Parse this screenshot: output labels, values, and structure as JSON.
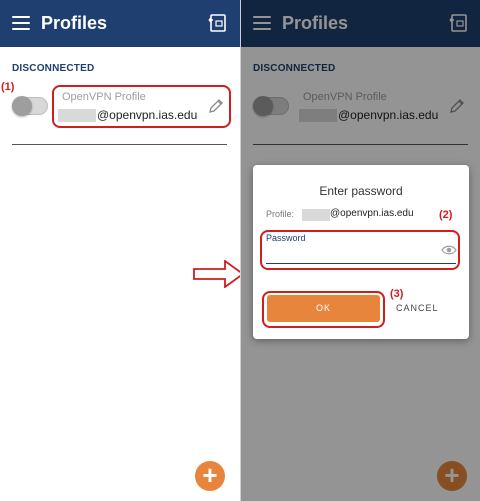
{
  "app": {
    "title": "Profiles",
    "header_color": "#1e3f6f",
    "accent_color": "#e8853d",
    "annotation_color": "#d11d1d",
    "icons": [
      "menu-icon",
      "import-profile-icon",
      "edit-pencil-icon",
      "add-icon",
      "eye-icon"
    ]
  },
  "status": {
    "label": "DISCONNECTED"
  },
  "profile": {
    "name": "OpenVPN Profile",
    "server": "@openvpn.ias.edu",
    "connected": false
  },
  "dialog": {
    "title": "Enter password",
    "profile_label": "Profile:",
    "profile_server": "@openvpn.ias.edu",
    "password_label": "Password",
    "password_value": "",
    "ok_label": "OK",
    "cancel_label": "CANCEL"
  },
  "annotations": {
    "step1": "(1)",
    "step2": "(2)",
    "step3": "(3)"
  },
  "fab": {
    "symbol": "+"
  }
}
